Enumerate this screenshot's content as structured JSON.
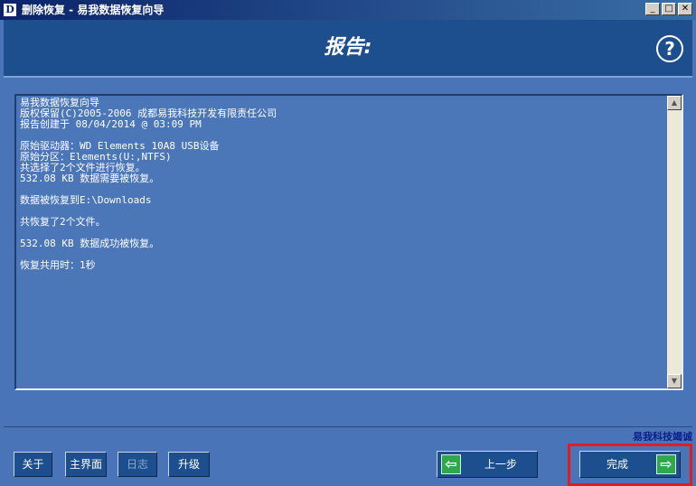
{
  "window": {
    "icon_letter": "D",
    "title": "删除恢复 - 易我数据恢复向导",
    "controls": [
      "_",
      "□",
      "✕"
    ]
  },
  "header": {
    "title": "报告:",
    "help_symbol": "?"
  },
  "report": {
    "text": "易我数据恢复向导\n版权保留(C)2005-2006 成都易我科技开发有限责任公司\n报告创建于 08/04/2014 @ 03:09 PM\n\n原始驱动器：WD Elements 10A8 USB设备\n原始分区：Elements(U:,NTFS)\n共选择了2个文件进行恢复。\n532.08 KB 数据需要被恢复。\n\n数据被恢复到E:\\Downloads\n\n共恢复了2个文件。\n\n532.08 KB 数据成功被恢复。\n\n恢复共用时：1秒"
  },
  "footer": {
    "link": "易我科技竭诚"
  },
  "buttons": {
    "about": "关于",
    "home": "主界面",
    "log": "日志",
    "upgrade": "升级",
    "prev": "上一步",
    "finish": "完成"
  },
  "colors": {
    "background": "#4a74b8",
    "header": "#1d4f8f",
    "button": "#1d4f8f",
    "arrow_green": "#2ea84a",
    "highlight_red": "#e21b1b"
  }
}
